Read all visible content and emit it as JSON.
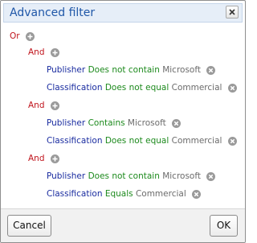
{
  "dialog": {
    "title": "Advanced filter",
    "close_icon": "close-icon"
  },
  "filter": {
    "root_operator": "Or",
    "groups": [
      {
        "operator": "And",
        "conditions": [
          {
            "field": "Publisher",
            "comparison": "Does not contain",
            "value": "Microsoft"
          },
          {
            "field": "Classification",
            "comparison": "Does not equal",
            "value": "Commercial"
          }
        ]
      },
      {
        "operator": "And",
        "conditions": [
          {
            "field": "Publisher",
            "comparison": "Contains",
            "value": "Microsoft"
          },
          {
            "field": "Classification",
            "comparison": "Does not equal",
            "value": "Commercial"
          }
        ]
      },
      {
        "operator": "And",
        "conditions": [
          {
            "field": "Publisher",
            "comparison": "Does not contain",
            "value": "Microsoft"
          },
          {
            "field": "Classification",
            "comparison": "Equals",
            "value": "Commercial"
          }
        ]
      }
    ]
  },
  "footer": {
    "cancel_label": "Cancel",
    "ok_label": "OK"
  },
  "colors": {
    "title": "#1f57a8",
    "operator": "#c0141c",
    "field": "#1a2ca0",
    "comparison": "#1d8a1d",
    "value": "#6b6b6b"
  }
}
